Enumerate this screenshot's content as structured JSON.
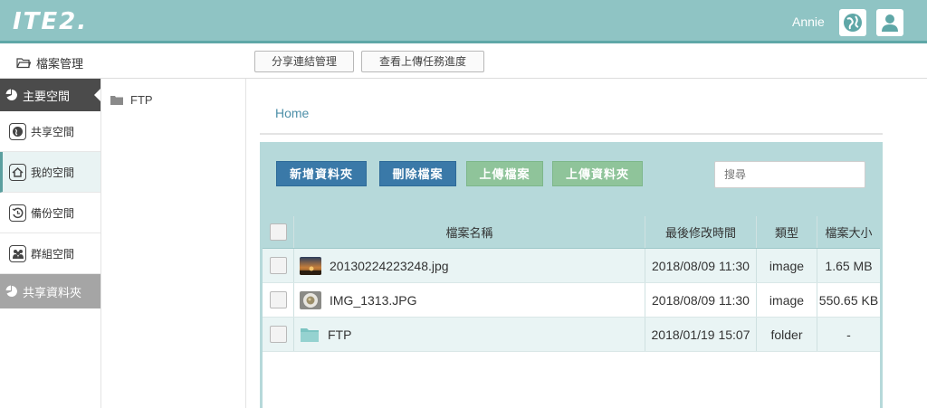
{
  "app": {
    "logo": "ITE2.",
    "user": "Annie"
  },
  "subbar": {
    "breadcrumb": "檔案管理",
    "share_mgr": "分享連結管理",
    "upload_progress": "查看上傳任務進度"
  },
  "nav": {
    "main_space": "主要空間",
    "items": [
      {
        "label": "共享空間",
        "icon": "globe-icon"
      },
      {
        "label": "我的空間",
        "icon": "home-icon"
      },
      {
        "label": "備份空間",
        "icon": "backup-icon"
      },
      {
        "label": "群組空間",
        "icon": "group-icon"
      }
    ],
    "shared_folder": "共享資料夾"
  },
  "tree": {
    "root": "FTP"
  },
  "main": {
    "home": "Home",
    "buttons": {
      "new_folder": "新增資料夾",
      "delete": "刪除檔案",
      "upload_file": "上傳檔案",
      "upload_folder": "上傳資料夾"
    },
    "search_placeholder": "搜尋",
    "columns": {
      "name": "檔案名稱",
      "modified": "最後修改時間",
      "type": "類型",
      "size": "檔案大小"
    },
    "files": [
      {
        "name": "20130224223248.jpg",
        "modified": "2018/08/09 11:30",
        "type": "image",
        "size": "1.65 MB",
        "thumb": "sunset-thumb"
      },
      {
        "name": "IMG_1313.JPG",
        "modified": "2018/08/09 11:30",
        "type": "image",
        "size": "550.65 KB",
        "thumb": "dish-thumb"
      },
      {
        "name": "FTP",
        "modified": "2018/01/19 15:07",
        "type": "folder",
        "size": "-",
        "thumb": "folder-icon"
      }
    ]
  },
  "colors": {
    "header": "#8fc4c4",
    "primary_btn": "#3a79a8",
    "secondary_btn": "#8fc49a",
    "panel": "#b6d9da"
  }
}
